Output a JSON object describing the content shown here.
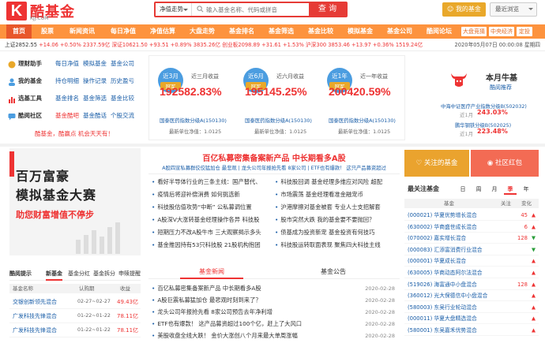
{
  "header": {
    "logo_mark": "K",
    "logo_name": "酷基金",
    "logo_domain": "KJJ.COM",
    "search_type": "净值走势",
    "search_placeholder": "输入基金名称、代码或拼音",
    "search_button": "查 询",
    "my_fund": "我的基金",
    "recent": "最近浏览"
  },
  "nav": {
    "items": [
      "首页",
      "股票",
      "新闻资讯",
      "每日净值",
      "净值估算",
      "大盘走势",
      "基金排名",
      "基金筛选",
      "基金比较",
      "模拟基金",
      "基金公司",
      "酷阅论坛"
    ],
    "active": 0,
    "small_buttons": [
      "大盘竞猜",
      "中央经济",
      "定投"
    ]
  },
  "ticker": {
    "text_a": "上证2852.55",
    "text_b": "+14.06 +0.50% 2337.59亿",
    "text_c": "深证10621.50 +93.51 +0.89% 3835.26亿",
    "text_d": "创业板2098.89 +31.61 +1.53%",
    "text_e": "沪深300 3853.46 +13.97 +0.36% 1519.24亿",
    "date": "2020年05月07日 00:00:08 星期四"
  },
  "menu": [
    {
      "head": "理财助手",
      "links": [
        "每日净值",
        "模拟基金",
        "基金公司"
      ]
    },
    {
      "head": "我的基金",
      "links": [
        "持仓明细",
        "操作记录",
        "历史盈亏"
      ]
    },
    {
      "head": "选基工具",
      "links": [
        "基金排名",
        "基金筛选",
        "基金比较"
      ]
    },
    {
      "head": "酷阅社区",
      "links": [
        "基金酷吧",
        "基金酷话",
        "个股交流"
      ]
    }
  ],
  "slogan": "酷基金，酷赢点 机会天天有！",
  "stats": [
    {
      "period": "近3月",
      "label": "冠军",
      "title": "近三月收益",
      "value": "192582.83%",
      "fund": "国泰医药指数分级A(150130)",
      "nav": "最新单位净值：1.0125"
    },
    {
      "period": "近6月",
      "label": "冠军",
      "title": "近六月收益",
      "value": "195145.25%",
      "fund": "国泰医药指数分级A(150130)",
      "nav": "最新单位净值：1.0125"
    },
    {
      "period": "近1年",
      "label": "冠军",
      "title": "近一年收益",
      "value": "200420.59%",
      "fund": "国泰医药指数分级A(150130)",
      "nav": "最新单位净值：1.0125"
    }
  ],
  "bull": {
    "title": "本月牛基",
    "sub": "酷阅推荐",
    "funds": [
      {
        "name": "中海中证医疗产业指数分级B(502032)",
        "pct": "243.03%",
        "label": "近1月"
      },
      {
        "name": "鹏华钢铁分级B(502025)",
        "pct": "223.48%",
        "label": "近1月"
      }
    ]
  },
  "banner": {
    "line1": "百万富豪",
    "line2": "模拟基金大赛",
    "line3": "助您财富增值不停步"
  },
  "news": {
    "title": "百亿私募密集备案新产品 中长期看多A股",
    "subtitle": "A股四宣私募群佼佼猛加仓 最悲观 | 龙头公司年报抢先看 8家公司 | ETF也有爆款！ 这只产品募资超过",
    "left": [
      "看好半导体行业的三条主线：国产替代、",
      "疫情后将迎补偿消费 如何挑选新",
      "科技股估值攻势“中断” 公私募调位置",
      "A股深V大涨转基金经理操作各异 科技股",
      "短期压力不改A股牛市 三大观察揭示多头",
      "基金推因持有53只科技股 21股机构抱团"
    ],
    "right": [
      "科技股回调 基金经理多维应对风险 超配",
      "市场震荡 基金经理看准金融宠币",
      "沪港摩擦对基金被套 专业人士支招解套",
      "股市突然大跌 我的基金要不要抛回？",
      "债基成为投资新宠 基金投资有何技巧",
      "科技股运转取面表现 聚焦四大科技主线"
    ],
    "tabs": [
      "基金新闻",
      "基金公告"
    ],
    "rows": [
      {
        "title": "百亿私募密集备案新产品 中长期看多A股",
        "date": "2020-02-28"
      },
      {
        "title": "A股巨震私募猛加仓 最悲观时刻到来了？",
        "date": "2020-02-28"
      },
      {
        "title": "龙头公司年报抢先看 8家公司预告去年净利增",
        "date": "2020-02-28"
      },
      {
        "title": "ETF也有爆款！ 这产品募资超过100个亿，赶上了大风口",
        "date": "2020-02-28"
      },
      {
        "title": "美股收盘全线大跌！ 金价大涨创八个月来最大单周涨幅",
        "date": "2020-02-28"
      }
    ]
  },
  "left_tabs": {
    "head": "酷阅提示",
    "tabs": [
      "新基金",
      "基金分红",
      "基金拆分",
      "申赎提醒"
    ],
    "active": 0
  },
  "left_table": {
    "headers": [
      "基金名称",
      "认购期",
      "收益"
    ],
    "rows": [
      {
        "name": "交银创新领先混合",
        "period": "02-27~02-27",
        "val": "49.43亿"
      },
      {
        "name": "广发科技先锋混合",
        "period": "01-22~01-22",
        "val": "78.11亿"
      },
      {
        "name": "广发科技先锋混合",
        "period": "01-22~01-22",
        "val": "78.11亿"
      }
    ]
  },
  "right": {
    "follow": "关注的基金",
    "redpack": "社区红包",
    "rank_head": "最关注基金",
    "periods": [
      "日",
      "周",
      "月",
      "季",
      "年"
    ],
    "active_period": 3,
    "headers": [
      "基金",
      "关注",
      "变化"
    ],
    "rows": [
      {
        "name": "(000021) 华夏优势增长混合",
        "cnt": "45",
        "dir": "up"
      },
      {
        "name": "(630002) 华商盛世成长混合",
        "cnt": "6",
        "dir": "up"
      },
      {
        "name": "(070002) 嘉实增长混合",
        "cnt": "128",
        "dir": "down"
      },
      {
        "name": "(000083) 汇添富消费行业混合",
        "cnt": "",
        "dir": "down"
      },
      {
        "name": "(000001) 华夏成长混合",
        "cnt": "",
        "dir": "up"
      },
      {
        "name": "(630005) 华商动态阿尔法混合",
        "cnt": "",
        "dir": "up"
      },
      {
        "name": "(519026) 海富通中小盘混合",
        "cnt": "128",
        "dir": "up"
      },
      {
        "name": "(360012) 光大保德信中小盘混合",
        "cnt": "",
        "dir": "up"
      },
      {
        "name": "(580003) 东吴行业轮动混合",
        "cnt": "",
        "dir": "up"
      },
      {
        "name": "(000011) 华夏大盘精选混合",
        "cnt": "",
        "dir": "up"
      },
      {
        "name": "(580001) 东吴嘉禾优势混合",
        "cnt": "",
        "dir": "up"
      }
    ]
  },
  "colors": {
    "accent": "#e63b36",
    "nav": "#fd933e",
    "gold": "#e9a82a",
    "blue": "#4b9de0"
  }
}
